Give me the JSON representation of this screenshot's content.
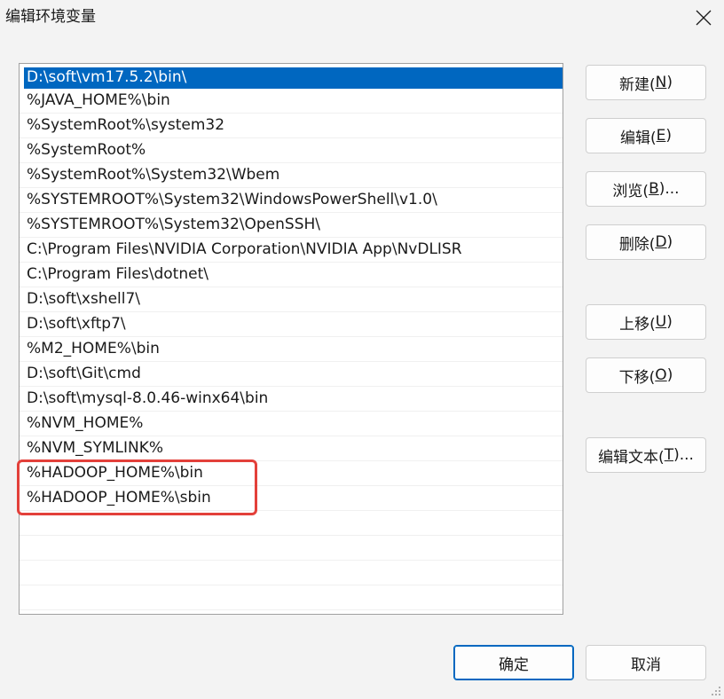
{
  "window": {
    "title": "编辑环境变量"
  },
  "list": {
    "selected_index": 0,
    "items": [
      "D:\\soft\\vm17.5.2\\bin\\",
      "%JAVA_HOME%\\bin",
      "%SystemRoot%\\system32",
      "%SystemRoot%",
      "%SystemRoot%\\System32\\Wbem",
      "%SYSTEMROOT%\\System32\\WindowsPowerShell\\v1.0\\",
      "%SYSTEMROOT%\\System32\\OpenSSH\\",
      "C:\\Program Files\\NVIDIA Corporation\\NVIDIA App\\NvDLISR",
      "C:\\Program Files\\dotnet\\",
      "D:\\soft\\xshell7\\",
      "D:\\soft\\xftp7\\",
      "%M2_HOME%\\bin",
      "D:\\soft\\Git\\cmd",
      "D:\\soft\\mysql-8.0.46-winx64\\bin",
      "%NVM_HOME%",
      "%NVM_SYMLINK%",
      "%HADOOP_HOME%\\bin",
      "%HADOOP_HOME%\\sbin"
    ]
  },
  "buttons": {
    "new": {
      "pre": "新建(",
      "key": "N",
      "post": ")"
    },
    "edit": {
      "pre": "编辑(",
      "key": "E",
      "post": ")"
    },
    "browse": {
      "pre": "浏览(",
      "key": "B",
      "post": ")..."
    },
    "delete": {
      "pre": "删除(",
      "key": "D",
      "post": ")"
    },
    "move_up": {
      "pre": "上移(",
      "key": "U",
      "post": ")"
    },
    "move_down": {
      "pre": "下移(",
      "key": "O",
      "post": ")"
    },
    "edit_text": {
      "pre": "编辑文本(",
      "key": "T",
      "post": ")..."
    },
    "ok": "确定",
    "cancel": "取消"
  },
  "colors": {
    "selection": "#0067c0",
    "highlight_annotation": "#e3403a",
    "background": "#f3f3f3"
  },
  "icons": {
    "close": "close-icon",
    "resize": "resize-grip-icon"
  }
}
